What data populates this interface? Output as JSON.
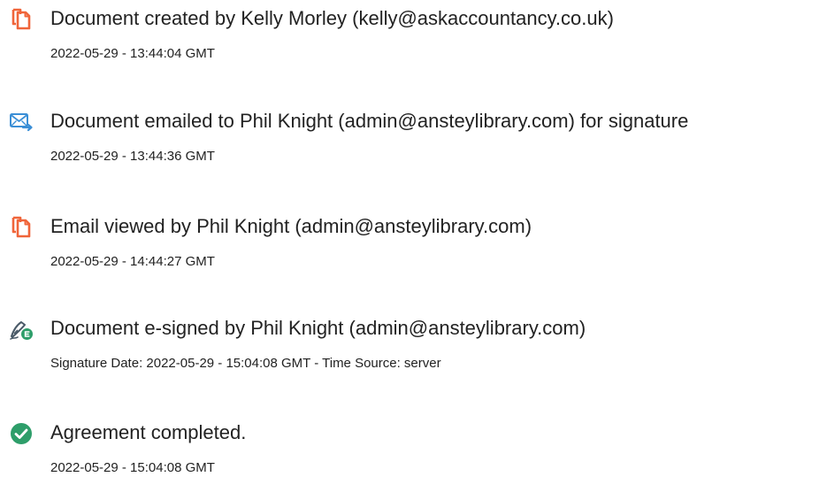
{
  "audit_events": [
    {
      "icon": "document-icon",
      "title": "Document created by Kelly Morley (kelly@askaccountancy.co.uk)",
      "timestamp": "2022-05-29 - 13:44:04 GMT"
    },
    {
      "icon": "email-sent-icon",
      "title": "Document emailed to Phil Knight (admin@ansteylibrary.com) for signature",
      "timestamp": "2022-05-29 - 13:44:36 GMT"
    },
    {
      "icon": "document-icon",
      "title": "Email viewed by Phil Knight (admin@ansteylibrary.com)",
      "timestamp": "2022-05-29 - 14:44:27 GMT"
    },
    {
      "icon": "e-sign-pen-icon",
      "title": "Document e-signed by Phil Knight (admin@ansteylibrary.com)",
      "timestamp": "Signature Date: 2022-05-29 - 15:04:08 GMT - Time Source: server"
    },
    {
      "icon": "check-circle-icon",
      "title": "Agreement completed.",
      "timestamp": "2022-05-29 - 15:04:08 GMT"
    }
  ],
  "colors": {
    "document_icon": "#f0653a",
    "email_icon": "#3b8fd6",
    "sign_icon": "#4a5a68",
    "check_icon": "#2e9e6a"
  }
}
